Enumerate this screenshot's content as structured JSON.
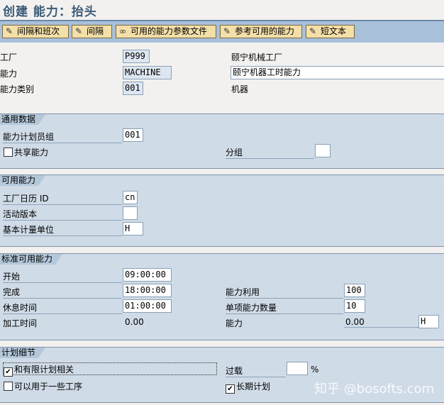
{
  "title": "创建 能力：抬头",
  "toolbar": [
    "间隔和班次",
    "间隔",
    "可用的能力参数文件",
    "参考可用的能力",
    "短文本"
  ],
  "header": {
    "plant_label": "工厂",
    "plant": "P999",
    "plant_desc": "颐宁机械工厂",
    "cap_label": "能力",
    "cap": "MACHINE",
    "cap_desc": "颐宁机器工时能力",
    "cat_label": "能力类别",
    "cat": "001",
    "cat_desc": "机器"
  },
  "general": {
    "title": "通用数据",
    "planner_label": "能力计划员组",
    "planner": "001",
    "pooled_label": "共享能力",
    "pooled": false,
    "grouping_label": "分组",
    "grouping": ""
  },
  "avail": {
    "title": "可用能力",
    "calendar_label": "工厂日历 ID",
    "calendar": "cn",
    "version_label": "活动版本",
    "version": "",
    "uom_label": "基本计量单位",
    "uom": "H"
  },
  "std": {
    "title": "标准可用能力",
    "start_label": "开始",
    "start": "09:00:00",
    "finish_label": "完成",
    "finish": "18:00:00",
    "break_label": "休息时间",
    "break": "01:00:00",
    "optime_label": "加工时间",
    "optime": "0.00",
    "util_label": "能力利用",
    "util": "100",
    "num_label": "单项能力数量",
    "num": "10",
    "capacity_label": "能力",
    "capacity": "0.00",
    "capacity_unit": "H"
  },
  "planning": {
    "title": "计划细节",
    "finite_label": "和有限计划相关",
    "finite": true,
    "multi_label": "可以用于一些工序",
    "multi": false,
    "overload_label": "过载",
    "overload": "",
    "pct": "%",
    "longterm_label": "长期计划",
    "longterm": true
  },
  "watermark": "知乎 @bosofts.com"
}
